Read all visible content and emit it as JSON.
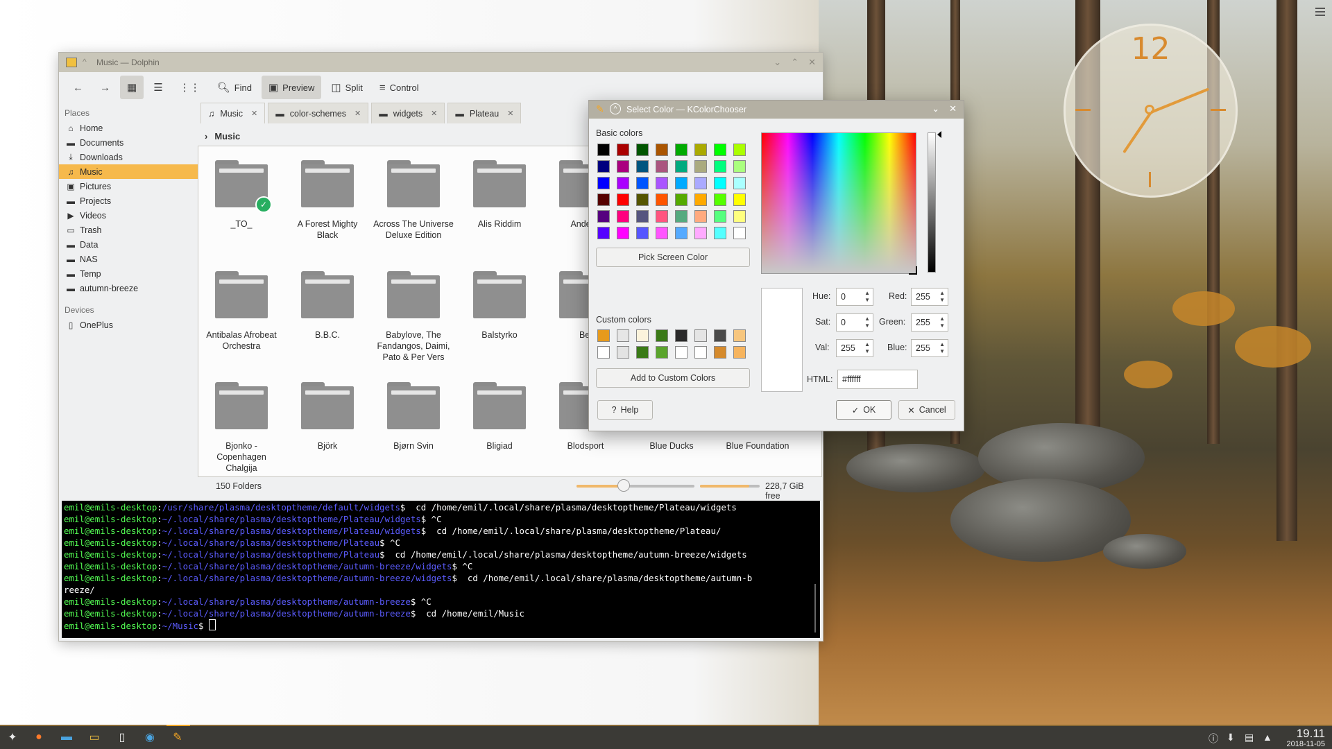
{
  "desktop": {
    "clock_numeral": "12"
  },
  "dolphin": {
    "title": "Music — Dolphin",
    "toolbar": {
      "find": "Find",
      "preview": "Preview",
      "split": "Split",
      "control": "Control"
    },
    "places_title": "Places",
    "places": [
      "Home",
      "Documents",
      "Downloads",
      "Music",
      "Pictures",
      "Projects",
      "Videos",
      "Trash",
      "Data",
      "NAS",
      "Temp",
      "autumn-breeze"
    ],
    "devices_title": "Devices",
    "devices": [
      "OnePlus"
    ],
    "tabs": [
      "Music",
      "color-schemes",
      "widgets",
      "Plateau"
    ],
    "breadcrumb": "Music",
    "folders": [
      "_TO_",
      "A Forest Mighty Black",
      "Across The Universe Deluxe Edition",
      "Alis Riddim",
      "Andeda",
      "",
      "",
      "Antibalas Afrobeat Orchestra",
      "B.B.C.",
      "Babylove, The Fandangos, Daimi, Pato & Per Vers",
      "Balstyrko",
      "Bel",
      "",
      "",
      "Bjonko - Copenhagen Chalgija",
      "Björk",
      "Bjørn Svin",
      "Bligiad",
      "Blodsport",
      "Blue Ducks",
      "Blue Foundation"
    ],
    "status": "150 Folders",
    "free_space": "228,7 GiB free",
    "zoom_fraction": 0.4,
    "free_fraction": 0.82
  },
  "terminal": {
    "lines": [
      {
        "user": "emil@emils-desktop",
        "path": "/usr/share/plasma/desktoptheme/default/widgets",
        "cmd": "  cd /home/emil/.local/share/plasma/desktoptheme/Plateau/widgets"
      },
      {
        "user": "emil@emils-desktop",
        "path": "~/.local/share/plasma/desktoptheme/Plateau/widgets",
        "cmd": " ^C"
      },
      {
        "user": "emil@emils-desktop",
        "path": "~/.local/share/plasma/desktoptheme/Plateau/widgets",
        "cmd": "  cd /home/emil/.local/share/plasma/desktoptheme/Plateau/"
      },
      {
        "user": "emil@emils-desktop",
        "path": "~/.local/share/plasma/desktoptheme/Plateau",
        "cmd": " ^C"
      },
      {
        "user": "emil@emils-desktop",
        "path": "~/.local/share/plasma/desktoptheme/Plateau",
        "cmd": "  cd /home/emil/.local/share/plasma/desktoptheme/autumn-breeze/widgets"
      },
      {
        "user": "emil@emils-desktop",
        "path": "~/.local/share/plasma/desktoptheme/autumn-breeze/widgets",
        "cmd": " ^C"
      },
      {
        "user": "emil@emils-desktop",
        "path": "~/.local/share/plasma/desktoptheme/autumn-breeze/widgets",
        "cmd": "  cd /home/emil/.local/share/plasma/desktoptheme/autumn-b"
      },
      {
        "user": "",
        "path": "",
        "cmd": "reeze/"
      },
      {
        "user": "emil@emils-desktop",
        "path": "~/.local/share/plasma/desktoptheme/autumn-breeze",
        "cmd": " ^C"
      },
      {
        "user": "emil@emils-desktop",
        "path": "~/.local/share/plasma/desktoptheme/autumn-breeze",
        "cmd": "  cd /home/emil/Music"
      },
      {
        "user": "emil@emils-desktop",
        "path": "~/Music",
        "cmd": " "
      }
    ]
  },
  "color_dialog": {
    "title": "Select Color — KColorChooser",
    "basic_colors_label": "Basic colors",
    "basic_colors": [
      "#000000",
      "#aa0000",
      "#005500",
      "#aa5500",
      "#00aa00",
      "#aaaa00",
      "#00ff00",
      "#aaff00",
      "#00007f",
      "#aa007f",
      "#00557f",
      "#aa557f",
      "#00aa7f",
      "#aaaa7f",
      "#00ff7f",
      "#aaff7f",
      "#0000ff",
      "#aa00ff",
      "#0055ff",
      "#aa55ff",
      "#00aaff",
      "#aaaaff",
      "#00ffff",
      "#aaffff",
      "#550000",
      "#ff0000",
      "#555500",
      "#ff5500",
      "#55aa00",
      "#ffaa00",
      "#55ff00",
      "#ffff00",
      "#55007f",
      "#ff007f",
      "#55557f",
      "#ff557f",
      "#55aa7f",
      "#ffaa7f",
      "#55ff7f",
      "#ffff7f",
      "#5500ff",
      "#ff00ff",
      "#5555ff",
      "#ff55ff",
      "#55aaff",
      "#ffaaff",
      "#55ffff",
      "#ffffff"
    ],
    "pick_screen": "Pick Screen Color",
    "custom_colors_label": "Custom colors",
    "custom_colors": [
      "#e69a1c",
      "#e6e6e6",
      "#fbf3dc",
      "#3a7a17",
      "#2a2a2a",
      "#e4e4e4",
      "#4a4a4a",
      "#f7c67e",
      "#ffffff",
      "#e3e3e3",
      "#3a7a17",
      "#5aa42c",
      "#ffffff",
      "#ffffff",
      "#d58a2c",
      "#f6b45e"
    ],
    "add_custom": "Add to Custom Colors",
    "fields": {
      "hue_label": "Hue:",
      "hue": "0",
      "sat_label": "Sat:",
      "sat": "0",
      "val_label": "Val:",
      "val": "255",
      "red_label": "Red:",
      "red": "255",
      "green_label": "Green:",
      "green": "255",
      "blue_label": "Blue:",
      "blue": "255",
      "html_label": "HTML:",
      "html": "#ffffff"
    },
    "help": "Help",
    "ok": "OK",
    "cancel": "Cancel"
  },
  "taskbar": {
    "time": "19.11",
    "date": "2018-11-05"
  }
}
